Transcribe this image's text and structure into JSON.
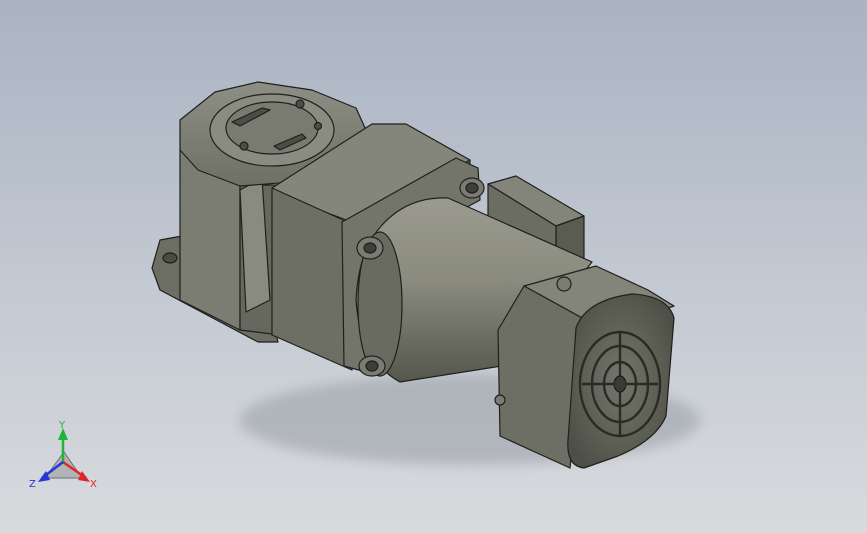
{
  "viewport": {
    "model": "gear-motor",
    "background": [
      "#a9b3c2",
      "#d8dadd"
    ]
  },
  "triad": {
    "x_label": "X",
    "y_label": "Y",
    "z_label": "Z",
    "x_color": "#e0262a",
    "y_color": "#1fb43b",
    "z_color": "#2a35d6"
  }
}
